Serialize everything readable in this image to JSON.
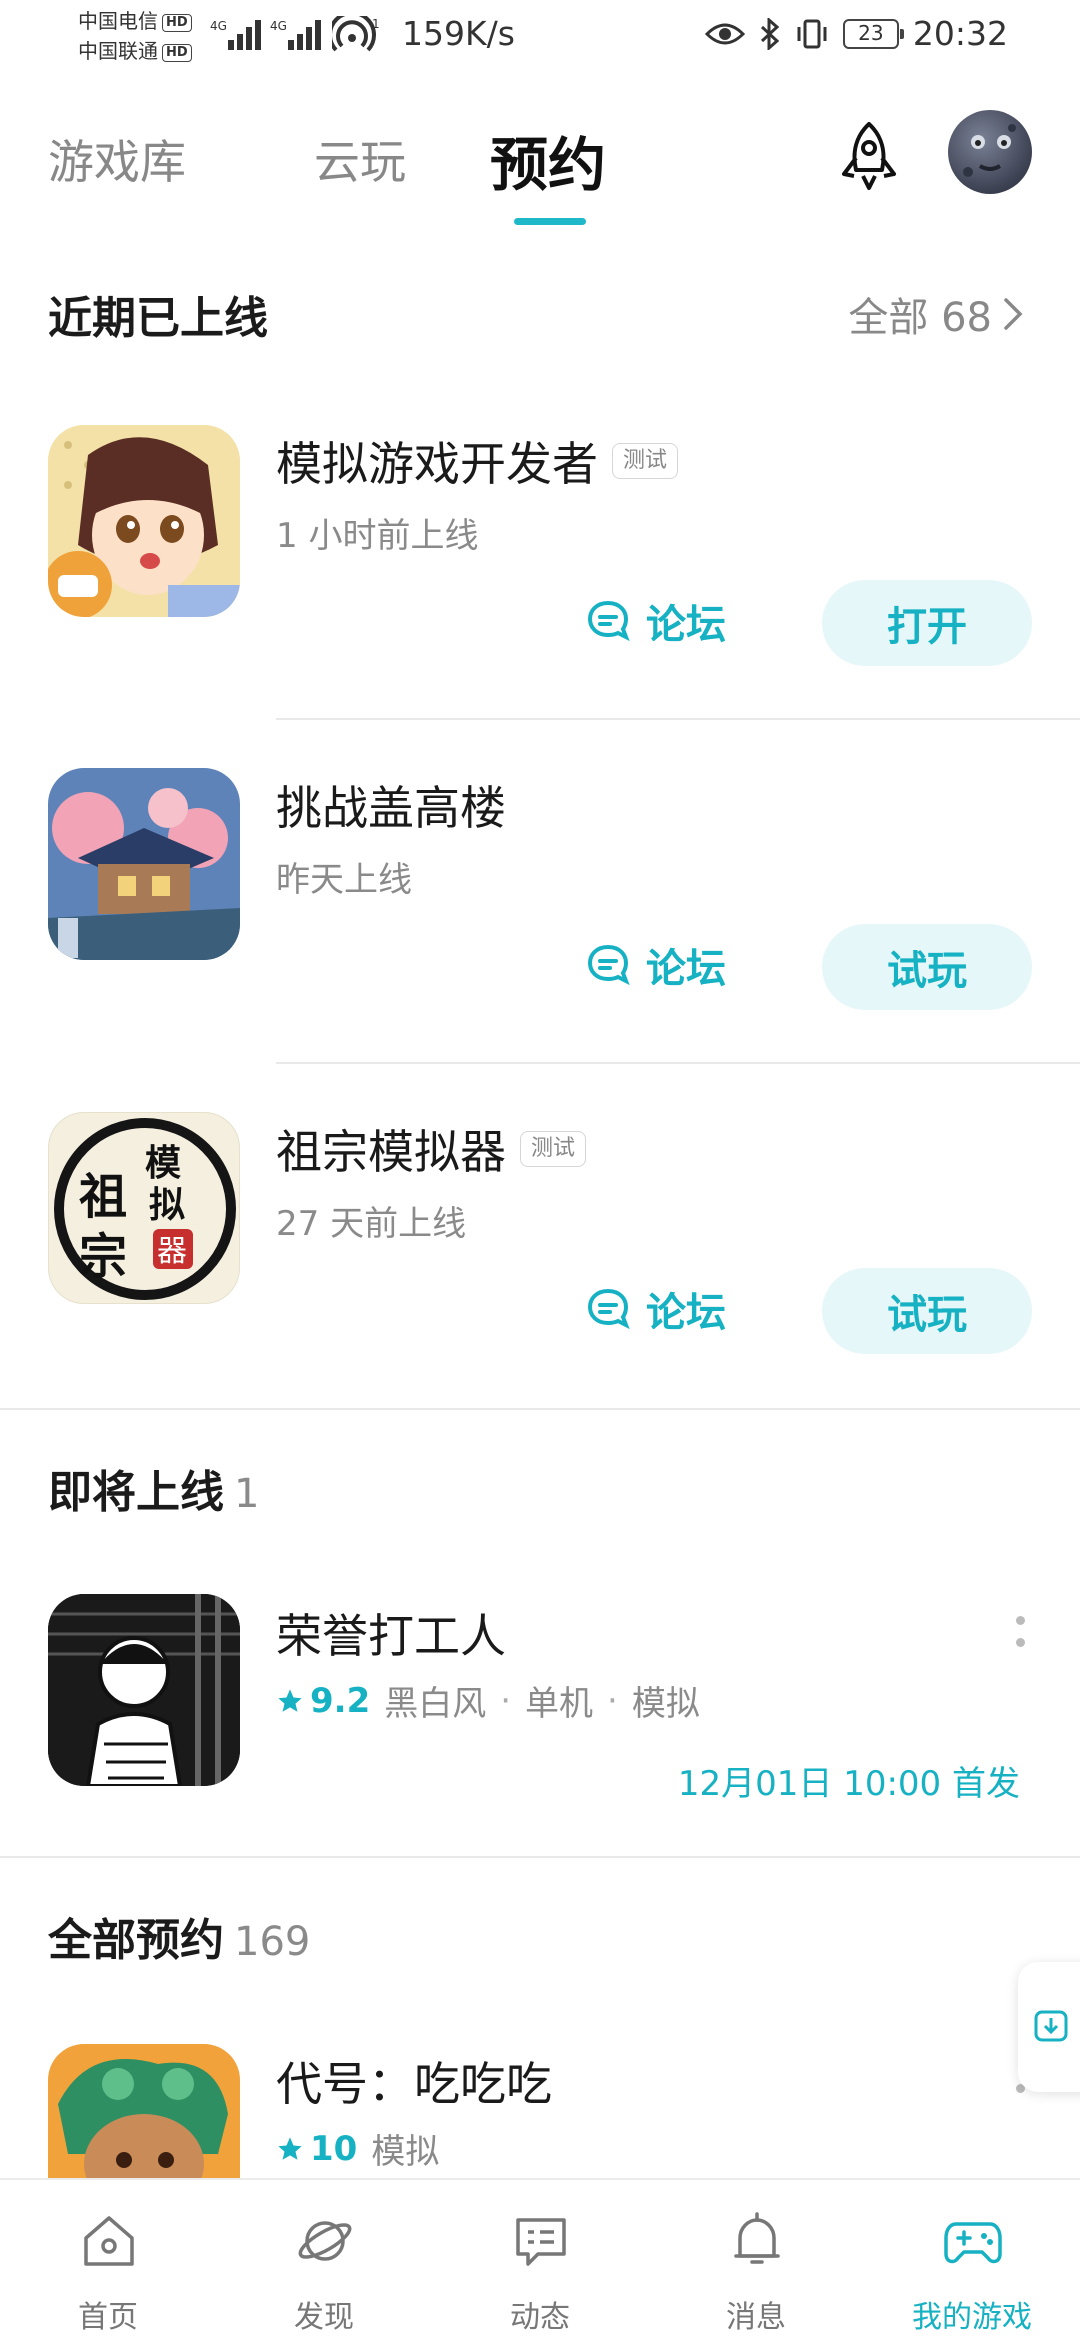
{
  "status_bar": {
    "carrier1": "中国电信",
    "carrier2": "中国联通",
    "hd": "HD",
    "net1": "4G",
    "net2": "4G",
    "speed": "159K/s",
    "battery": "23",
    "time": "20:32"
  },
  "tabs": [
    {
      "label": "游戏库",
      "active": false
    },
    {
      "label": "云玩",
      "active": false
    },
    {
      "label": "预约",
      "active": true
    }
  ],
  "recent": {
    "title": "近期已上线",
    "see_all": "全部 68",
    "items": [
      {
        "name": "模拟游戏开发者",
        "tag": "测试",
        "sub": "1 小时前上线",
        "forum": "论坛",
        "action": "打开"
      },
      {
        "name": "挑战盖高楼",
        "tag": "",
        "sub": "昨天上线",
        "forum": "论坛",
        "action": "试玩"
      },
      {
        "name": "祖宗模拟器",
        "tag": "测试",
        "sub": "27 天前上线",
        "forum": "论坛",
        "action": "试玩"
      }
    ]
  },
  "upcoming": {
    "title": "即将上线",
    "count": "1",
    "item": {
      "name": "荣誉打工人",
      "rating": "9.2",
      "tags": [
        "黑白风",
        "单机",
        "模拟"
      ],
      "release": "12月01日 10:00 首发"
    }
  },
  "all_reserved": {
    "title": "全部预约",
    "count": "169",
    "item": {
      "name": "代号：吃吃吃",
      "rating": "10",
      "tags": [
        "模拟"
      ]
    }
  },
  "icon_texts": {
    "zuzong": [
      "祖",
      "宗",
      "模",
      "拟",
      "器"
    ]
  },
  "bottom_nav": [
    {
      "label": "首页",
      "icon": "home-icon"
    },
    {
      "label": "发现",
      "icon": "planet-icon"
    },
    {
      "label": "动态",
      "icon": "chat-icon"
    },
    {
      "label": "消息",
      "icon": "bell-icon"
    },
    {
      "label": "我的游戏",
      "icon": "gamepad-icon",
      "active": true
    }
  ],
  "colors": {
    "accent": "#16b1c2",
    "pill_bg": "#e6f7f9"
  }
}
